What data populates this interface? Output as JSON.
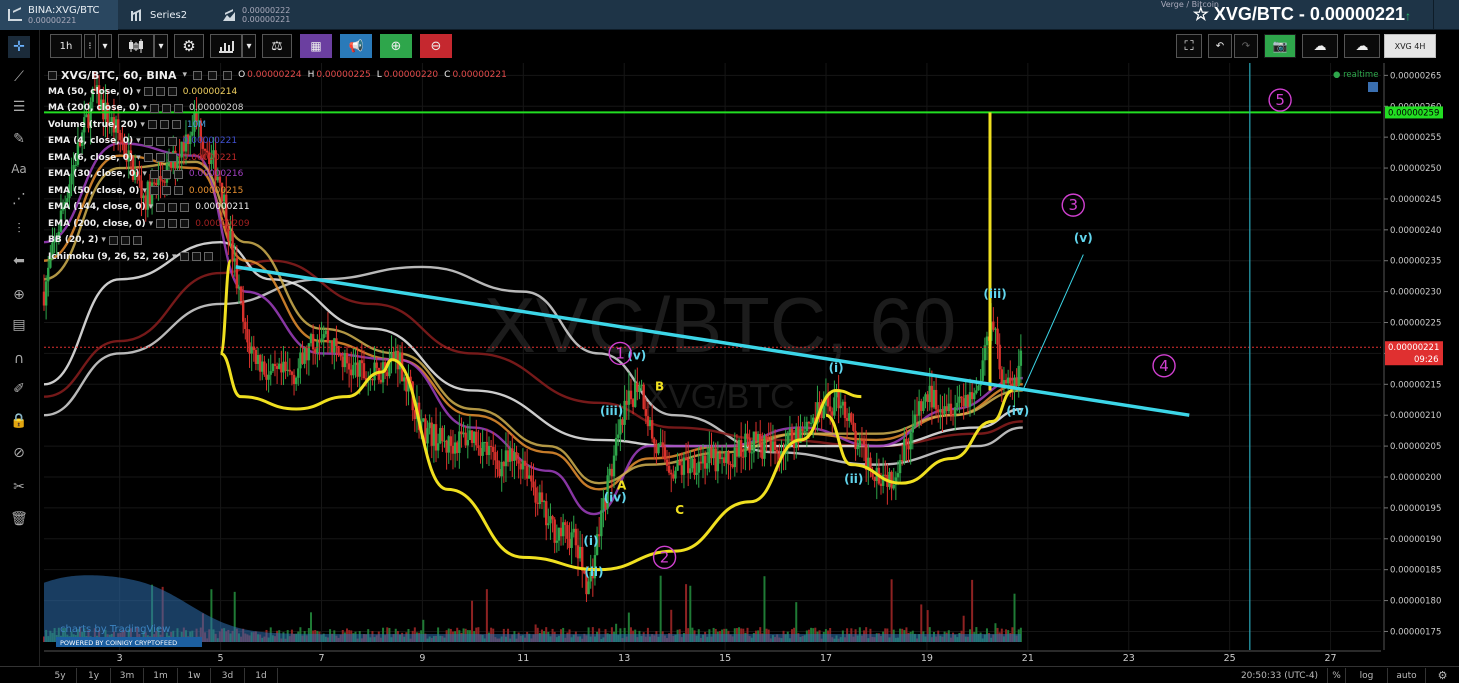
{
  "top_tabs": [
    {
      "label": "BINA:XVG/BTC",
      "sub": "0.00000221",
      "active": true
    },
    {
      "label": "Series2",
      "sub": ""
    },
    {
      "label": "0.00000222",
      "sub": "0.00000221"
    }
  ],
  "symbol": {
    "subtitle": "Verge / Bitcoin",
    "title": "XVG/BTC - 0.00000221",
    "arrow": "↑"
  },
  "toolbar": {
    "interval": "1h",
    "dots": "⁝",
    "chevron": "▾",
    "preset_label": "XVG 4H"
  },
  "legend": {
    "main": "XVG/BTC, 60, BINA",
    "ohlc": {
      "o_label": "O",
      "o": "0.00000224",
      "h_label": "H",
      "h": "0.00000225",
      "l_label": "L",
      "l": "0.00000220",
      "c_label": "C",
      "c": "0.00000221"
    },
    "indicators": [
      {
        "label": "MA (50, close, 0)",
        "value": "0.00000214",
        "color": "#f0d060"
      },
      {
        "label": "MA (200, close, 0)",
        "value": "0.00000208",
        "color": "#d0d0d0"
      },
      {
        "label": "Volume (true, 20)",
        "value": "10M",
        "color": "#4aa0e0"
      },
      {
        "label": "EMA (4, close, 0)",
        "value": "0.00000221",
        "color": "#4050d0"
      },
      {
        "label": "EMA (6, close, 0)",
        "value": "0.00000221",
        "color": "#c02828"
      },
      {
        "label": "EMA (30, close, 0)",
        "value": "0.00000216",
        "color": "#a040c0"
      },
      {
        "label": "EMA (50, close, 0)",
        "value": "0.00000215",
        "color": "#e89030"
      },
      {
        "label": "EMA (144, close, 0)",
        "value": "0.00000211",
        "color": "#f0f0f0"
      },
      {
        "label": "EMA (200, close, 0)",
        "value": "0.00000209",
        "color": "#a02020"
      },
      {
        "label": "BB (20, 2)",
        "value": "",
        "color": "#888"
      },
      {
        "label": "Ichimoku (9, 26, 52, 26)",
        "value": "",
        "color": "#888"
      }
    ]
  },
  "chart_data": {
    "type": "line",
    "title": "XVG/BTC, 60, BINA",
    "watermark": "XVG/BTC, 60",
    "watermark_sub": "XVG/BTC",
    "x_ticks": [
      "3",
      "5",
      "7",
      "9",
      "11",
      "13",
      "15",
      "17",
      "19",
      "21",
      "23",
      "25",
      "27"
    ],
    "y_ticks": [
      "0.00000265",
      "0.00000260",
      "0.00000255",
      "0.00000250",
      "0.00000245",
      "0.00000240",
      "0.00000235",
      "0.00000230",
      "0.00000225",
      "0.00000220",
      "0.00000215",
      "0.00000210",
      "0.00000205",
      "0.00000200",
      "0.00000195",
      "0.00000190",
      "0.00000185",
      "0.00000180",
      "0.00000175"
    ],
    "ylim": [
      1.72e-06,
      2.67e-06
    ],
    "xlim": [
      1.5,
      28.0
    ],
    "price_series": {
      "name": "XVG/BTC close",
      "x": [
        1.5,
        2.0,
        2.5,
        3.0,
        3.5,
        4.0,
        4.5,
        5.0,
        5.2,
        5.5,
        6.0,
        6.5,
        7.0,
        7.5,
        8.0,
        8.5,
        9.0,
        9.5,
        10.0,
        10.5,
        11.0,
        11.5,
        12.0,
        12.3,
        12.6,
        13.0,
        13.3,
        13.6,
        14.0,
        14.5,
        15.0,
        15.5,
        16.0,
        16.5,
        17.0,
        17.3,
        17.6,
        18.0,
        18.3,
        18.6,
        19.0,
        19.5,
        20.0,
        20.3,
        20.5,
        20.7,
        20.9
      ],
      "y": [
        2.3e-06,
        2.48e-06,
        2.62e-06,
        2.55e-06,
        2.45e-06,
        2.5e-06,
        2.58e-06,
        2.48e-06,
        2.38e-06,
        2.22e-06,
        2.16e-06,
        2.17e-06,
        2.24e-06,
        2.18e-06,
        2.16e-06,
        2.2e-06,
        2.08e-06,
        2.05e-06,
        2.07e-06,
        2.02e-06,
        2.03e-06,
        1.92e-06,
        1.9e-06,
        1.82e-06,
        1.96e-06,
        2.1e-06,
        2.16e-06,
        2.05e-06,
        2.01e-06,
        2.03e-06,
        2.02e-06,
        2.06e-06,
        2.04e-06,
        2.08e-06,
        2.11e-06,
        2.13e-06,
        2.05e-06,
        2.01e-06,
        2e-06,
        2.06e-06,
        2.13e-06,
        2.12e-06,
        2.14e-06,
        2.27e-06,
        2.15e-06,
        2.14e-06,
        2.21e-06
      ]
    },
    "moving_averages": [
      {
        "name": "MA 200",
        "color": "#d8d8d8",
        "x": [
          1.5,
          3.0,
          5.0,
          7.0,
          9.0,
          11.0,
          12.5,
          14.0,
          16.0,
          18.0,
          20.0,
          20.9
        ],
        "y": [
          2.1e-06,
          2.2e-06,
          2.28e-06,
          2.32e-06,
          2.34e-06,
          2.3e-06,
          2.2e-06,
          2.1e-06,
          2.04e-06,
          2.02e-06,
          2.05e-06,
          2.08e-06
        ]
      },
      {
        "name": "EMA 200",
        "color": "#8a1d1d",
        "x": [
          1.5,
          3.0,
          5.0,
          6.0,
          8.0,
          10.0,
          12.5,
          14.0,
          16.0,
          18.0,
          20.0,
          20.9
        ],
        "y": [
          2.13e-06,
          2.22e-06,
          2.33e-06,
          2.35e-06,
          2.28e-06,
          2.2e-06,
          2.12e-06,
          2.08e-06,
          2.06e-06,
          2.05e-06,
          2.07e-06,
          2.09e-06
        ]
      },
      {
        "name": "EMA 144",
        "color": "#f0f0f0",
        "x": [
          1.5,
          3.0,
          5.0,
          6.0,
          8.0,
          10.0,
          12.5,
          14.0,
          16.0,
          18.0,
          20.0,
          20.9
        ],
        "y": [
          2.15e-06,
          2.32e-06,
          2.38e-06,
          2.32e-06,
          2.24e-06,
          2.14e-06,
          2.06e-06,
          2.05e-06,
          2.05e-06,
          2.05e-06,
          2.08e-06,
          2.11e-06
        ]
      },
      {
        "name": "EMA 50",
        "color": "#e89030",
        "x": [
          1.5,
          3.0,
          4.5,
          5.5,
          7.0,
          8.5,
          10.0,
          11.5,
          12.5,
          13.5,
          15.0,
          16.5,
          18.0,
          19.5,
          20.9
        ],
        "y": [
          2.35e-06,
          2.52e-06,
          2.5e-06,
          2.35e-06,
          2.22e-06,
          2.19e-06,
          2.1e-06,
          2.04e-06,
          1.98e-06,
          2.03e-06,
          2.05e-06,
          2.07e-06,
          2.06e-06,
          2.1e-06,
          2.15e-06
        ]
      },
      {
        "name": "EMA 30",
        "color": "#a040c0",
        "x": [
          1.5,
          3.0,
          4.5,
          5.5,
          7.0,
          8.5,
          10.0,
          11.5,
          12.4,
          13.5,
          15.0,
          16.5,
          18.0,
          19.5,
          20.9
        ],
        "y": [
          2.38e-06,
          2.54e-06,
          2.52e-06,
          2.3e-06,
          2.2e-06,
          2.19e-06,
          2.08e-06,
          2.01e-06,
          1.94e-06,
          2.05e-06,
          2.05e-06,
          2.08e-06,
          2.05e-06,
          2.11e-06,
          2.16e-06
        ]
      },
      {
        "name": "MA 50",
        "color": "#d0b050",
        "x": [
          1.5,
          3.0,
          4.5,
          5.5,
          7.0,
          8.5,
          10.0,
          11.5,
          12.5,
          13.5,
          15.0,
          16.5,
          18.0,
          19.5,
          20.9
        ],
        "y": [
          2.32e-06,
          2.5e-06,
          2.51e-06,
          2.38e-06,
          2.24e-06,
          2.2e-06,
          2.11e-06,
          2.05e-06,
          1.99e-06,
          2.02e-06,
          2.04e-06,
          2.07e-06,
          2.07e-06,
          2.1e-06,
          2.14e-06
        ]
      }
    ],
    "drawings": {
      "resistance_level": {
        "value": 2.59e-06,
        "label": "0.00000259",
        "color": "#22dd22"
      },
      "current_price": {
        "value": 2.21e-06,
        "label": "0.00000221",
        "countdown": "09:26",
        "color": "#e03030"
      },
      "trendline": {
        "color": "#3cd6e8",
        "x": [
          5.3,
          24.2
        ],
        "y": [
          2.34e-06,
          2.1e-06
        ]
      },
      "vertical_marker_x": 25.4,
      "projection": {
        "color": "#3cd6e8",
        "x": [
          20.9,
          22.1
        ],
        "y": [
          2.14e-06,
          2.36e-06
        ]
      },
      "cup_handle": [
        {
          "color": "#f0e020",
          "x": [
            5.2,
            5.0,
            5.4,
            6.5,
            7.5,
            8.2,
            8.4
          ],
          "y": [
            2.35e-06,
            2.2e-06,
            2.13e-06,
            2.11e-06,
            2.13e-06,
            2.17e-06,
            2.19e-06
          ]
        },
        {
          "color": "#f0e020",
          "x": [
            8.4,
            9.5,
            11.0,
            12.5,
            14.0,
            15.5,
            16.5,
            17.2,
            17.7
          ],
          "y": [
            2.19e-06,
            1.98e-06,
            1.87e-06,
            1.85e-06,
            1.88e-06,
            1.96e-06,
            2.06e-06,
            2.14e-06,
            2.13e-06
          ]
        },
        {
          "color": "#f0e020",
          "x": [
            17.0,
            17.5,
            18.5,
            19.5,
            20.3,
            20.7
          ],
          "y": [
            2.1e-06,
            2.02e-06,
            1.99e-06,
            2.03e-06,
            2.09e-06,
            2.14e-06
          ]
        },
        {
          "color": "#f0e020",
          "x": [
            20.25,
            20.25
          ],
          "y": [
            2.14e-06,
            2.59e-06
          ]
        }
      ],
      "wave_labels": [
        {
          "text": "(i)",
          "x": 12.34,
          "y": 1.89e-06,
          "color": "#62d6ee"
        },
        {
          "text": "(ii)",
          "x": 12.4,
          "y": 1.84e-06,
          "color": "#62d6ee"
        },
        {
          "text": "(iii)",
          "x": 12.75,
          "y": 2.1e-06,
          "color": "#62d6ee"
        },
        {
          "text": "(iv)",
          "x": 12.82,
          "y": 1.96e-06,
          "color": "#62d6ee"
        },
        {
          "text": "(v)",
          "x": 13.25,
          "y": 2.19e-06,
          "color": "#62d6ee"
        },
        {
          "text": "A",
          "x": 12.95,
          "y": 1.98e-06,
          "color": "#f0e020"
        },
        {
          "text": "B",
          "x": 13.7,
          "y": 2.14e-06,
          "color": "#f0e020"
        },
        {
          "text": "C",
          "x": 14.1,
          "y": 1.94e-06,
          "color": "#f0e020"
        },
        {
          "text": "(i)",
          "x": 17.2,
          "y": 2.17e-06,
          "color": "#62d6ee"
        },
        {
          "text": "(ii)",
          "x": 17.55,
          "y": 1.99e-06,
          "color": "#62d6ee"
        },
        {
          "text": "(iii)",
          "x": 20.35,
          "y": 2.29e-06,
          "color": "#62d6ee"
        },
        {
          "text": "(iv)",
          "x": 20.8,
          "y": 2.1e-06,
          "color": "#62d6ee"
        },
        {
          "text": "(v)",
          "x": 22.1,
          "y": 2.38e-06,
          "color": "#62d6ee"
        }
      ],
      "circle_labels": [
        {
          "text": "1",
          "x": 12.92,
          "y": 2.2e-06
        },
        {
          "text": "2",
          "x": 13.8,
          "y": 1.87e-06
        },
        {
          "text": "3",
          "x": 21.9,
          "y": 2.44e-06
        },
        {
          "text": "4",
          "x": 23.7,
          "y": 2.18e-06
        },
        {
          "text": "5",
          "x": 26.0,
          "y": 2.61e-06
        }
      ]
    },
    "realtime_label": "● realtime",
    "credits": [
      "charts by TradingView",
      "POWERED BY COINIGY CRYPTOFEED"
    ]
  },
  "bottom": {
    "ranges": [
      "5y",
      "1y",
      "3m",
      "1m",
      "1w",
      "3d",
      "1d"
    ],
    "clock": "20:50:33 (UTC-4)",
    "options": [
      "%",
      "log",
      "auto"
    ]
  },
  "colors": {
    "bg": "#000000",
    "up": "#2ea64b",
    "down": "#d9312c",
    "grid": "#1a1a1a",
    "accent": "#3cd6e8"
  }
}
